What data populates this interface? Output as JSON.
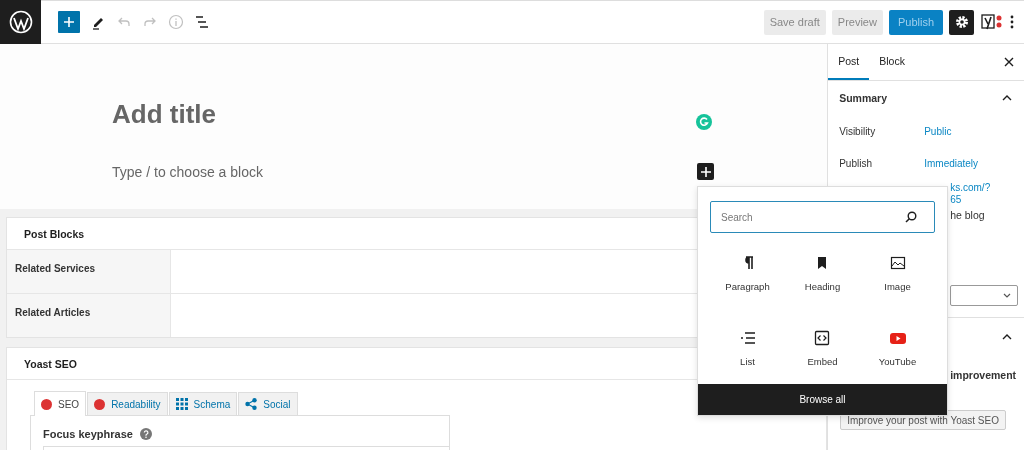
{
  "toolbar": {
    "undo": {
      "disabled": true
    },
    "redo": {
      "disabled": true
    }
  },
  "actions": [
    {
      "label": "Save draft",
      "kind": "secondary"
    },
    {
      "label": "Preview",
      "kind": "secondary"
    },
    {
      "label": "Publish",
      "kind": "primary"
    }
  ],
  "settings": {
    "pressed": true
  },
  "editor": {
    "title_placeholder": "Add title",
    "block_placeholder": "Type / to choose a block"
  },
  "post_blocks": {
    "title": "Post Blocks",
    "rows": [
      {
        "label": "Related Services"
      },
      {
        "label": "Related Articles"
      }
    ]
  },
  "yoast": {
    "title": "Yoast SEO",
    "tabs": [
      {
        "label": "SEO",
        "kind": "dot",
        "color": "#dc3232",
        "selected": true
      },
      {
        "label": "Readability",
        "kind": "dot",
        "color": "#dc3232",
        "selected": false
      },
      {
        "label": "Schema",
        "kind": "grid",
        "selected": false
      },
      {
        "label": "Social",
        "kind": "share",
        "selected": false
      }
    ],
    "focus_label": "Focus keyphrase"
  },
  "inserter": {
    "search_placeholder": "Search",
    "blocks": [
      {
        "label": "Paragraph",
        "kind": "paragraph"
      },
      {
        "label": "Heading",
        "kind": "heading"
      },
      {
        "label": "Image",
        "kind": "image"
      },
      {
        "label": "List",
        "kind": "list"
      },
      {
        "label": "Embed",
        "kind": "embed"
      },
      {
        "label": "YouTube",
        "kind": "youtube"
      }
    ],
    "browse_all": "Browse all"
  },
  "sidebar": {
    "tabs": [
      {
        "label": "Post",
        "selected": true
      },
      {
        "label": "Block",
        "selected": false
      }
    ],
    "summary": {
      "title": "Summary",
      "expanded": true,
      "rows": [
        {
          "label": "Visibility",
          "value": "Public"
        },
        {
          "label": "Publish",
          "value": "Immediately"
        }
      ],
      "link_lines": [
        "ks.com/?",
        "65"
      ],
      "text_fragment": "he blog"
    },
    "yoast_panel": {
      "expanded": true,
      "text_fragment": "improvement",
      "button": "Improve your post with Yoast SEO"
    }
  }
}
